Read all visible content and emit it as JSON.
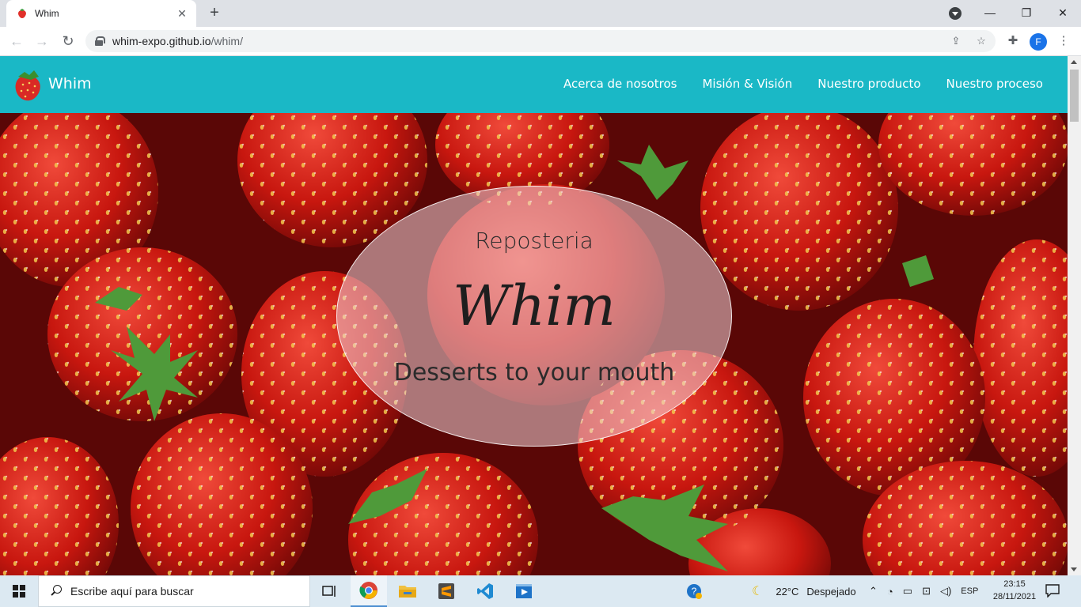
{
  "browser": {
    "tab_title": "Whim",
    "url_host": "whim-expo.github.io",
    "url_path": "/whim/",
    "profile_initial": "F",
    "new_tab_label": "+",
    "tab_close_label": "✕",
    "minimize_label": "—",
    "restore_label": "❐",
    "close_label": "✕"
  },
  "site": {
    "brand_name": "Whim",
    "nav": [
      {
        "label": "Acerca de nosotros"
      },
      {
        "label": "Misión & Visión"
      },
      {
        "label": "Nuestro producto"
      },
      {
        "label": "Nuestro proceso"
      }
    ],
    "hero": {
      "subtitle": "Reposteria",
      "title": "Whim",
      "tagline": "Desserts to your mouth"
    },
    "colors": {
      "navbar": "#1ab8c6",
      "hero_bg": "#7a0c0a",
      "oval_fill": "rgba(240,210,215,0.55)"
    }
  },
  "taskbar": {
    "search_placeholder": "Escribe aquí para buscar",
    "apps": [
      "task-view-icon",
      "chrome-icon",
      "file-explorer-icon",
      "sublime-text-icon",
      "vscode-icon",
      "media-player-icon"
    ],
    "weather_temp": "22°C",
    "weather_desc": "Despejado",
    "language": "ESP",
    "time": "23:15",
    "date": "28/11/2021"
  }
}
